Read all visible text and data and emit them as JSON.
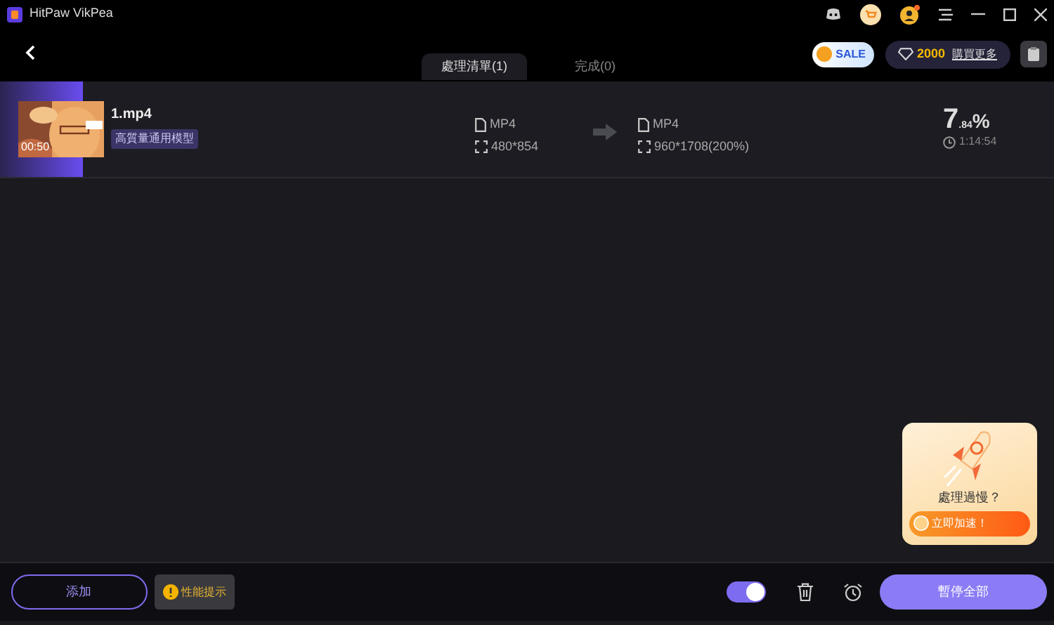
{
  "window": {
    "title": "HitPaw VikPea"
  },
  "header": {
    "sale_badge": "SALE",
    "credits": "2000",
    "buy_more": "購買更多"
  },
  "tabs": [
    {
      "label": "處理清單(1)",
      "selected": true
    },
    {
      "label": "完成(0)",
      "selected": false
    }
  ],
  "tasks": [
    {
      "thumbnail": {
        "kind": "picture",
        "duration": "00:50"
      },
      "name": "1.mp4",
      "model_tag": "高質量通用模型",
      "source_format": "MP4",
      "source_size": "480*854",
      "target_format": "MP4",
      "target_size": "960*1708(200%)",
      "percent_int": "7",
      "percent_frac": ".84",
      "percent_sign": "%",
      "remaining": "1:14:54",
      "level": 0.0784
    }
  ],
  "promo": {
    "question": "處理過慢？",
    "action": "立即加速！"
  },
  "footer": {
    "add_button": "添加",
    "hint_button": "性能提示",
    "notify_toggle": {
      "on": true
    },
    "pause_all": "暫停全部"
  }
}
